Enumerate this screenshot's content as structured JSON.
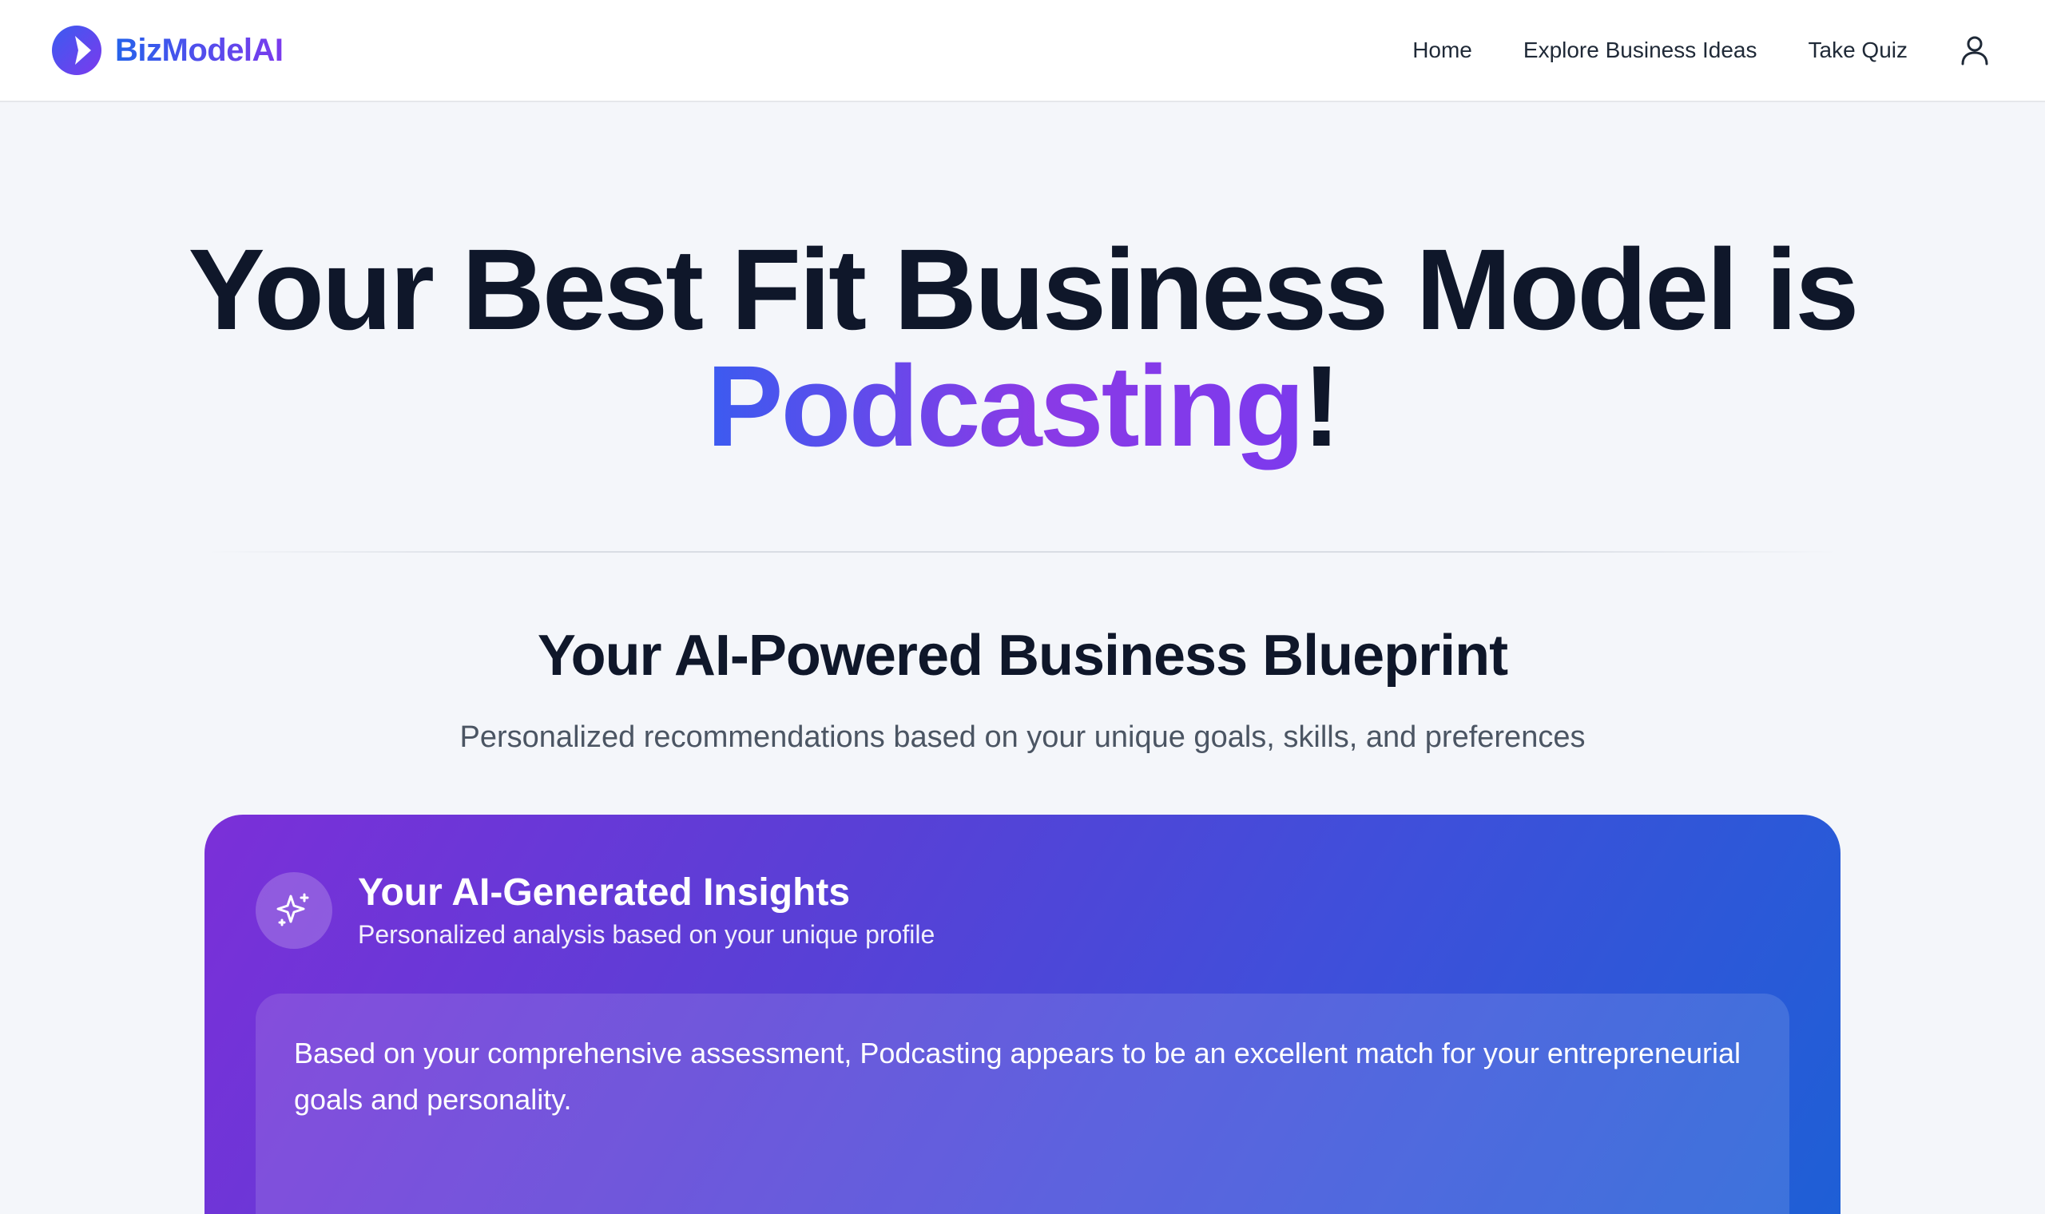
{
  "nav": {
    "brand": "BizModelAI",
    "links": [
      "Home",
      "Explore Business Ideas",
      "Take Quiz"
    ],
    "user_icon": "user-icon"
  },
  "hero": {
    "title_prefix": "Your Best Fit Business Model is",
    "highlight": "Podcasting",
    "suffix": "!"
  },
  "blueprint": {
    "title": "Your AI-Powered Business Blueprint",
    "subtitle": "Personalized recommendations based on your unique goals, skills, and preferences"
  },
  "insights": {
    "icon": "sparkle-icon",
    "title": "Your AI-Generated Insights",
    "subtitle": "Personalized analysis based on your unique profile",
    "text": "Based on your comprehensive assessment, Podcasting appears to be an excellent match for your entrepreneurial goals and personality."
  },
  "colors": {
    "brand": "#4f46e5",
    "gradient_start": "#3b5bf0",
    "gradient_end": "#8a3ae6",
    "card_start": "#7b2fd8",
    "card_end": "#1e5fd6"
  }
}
